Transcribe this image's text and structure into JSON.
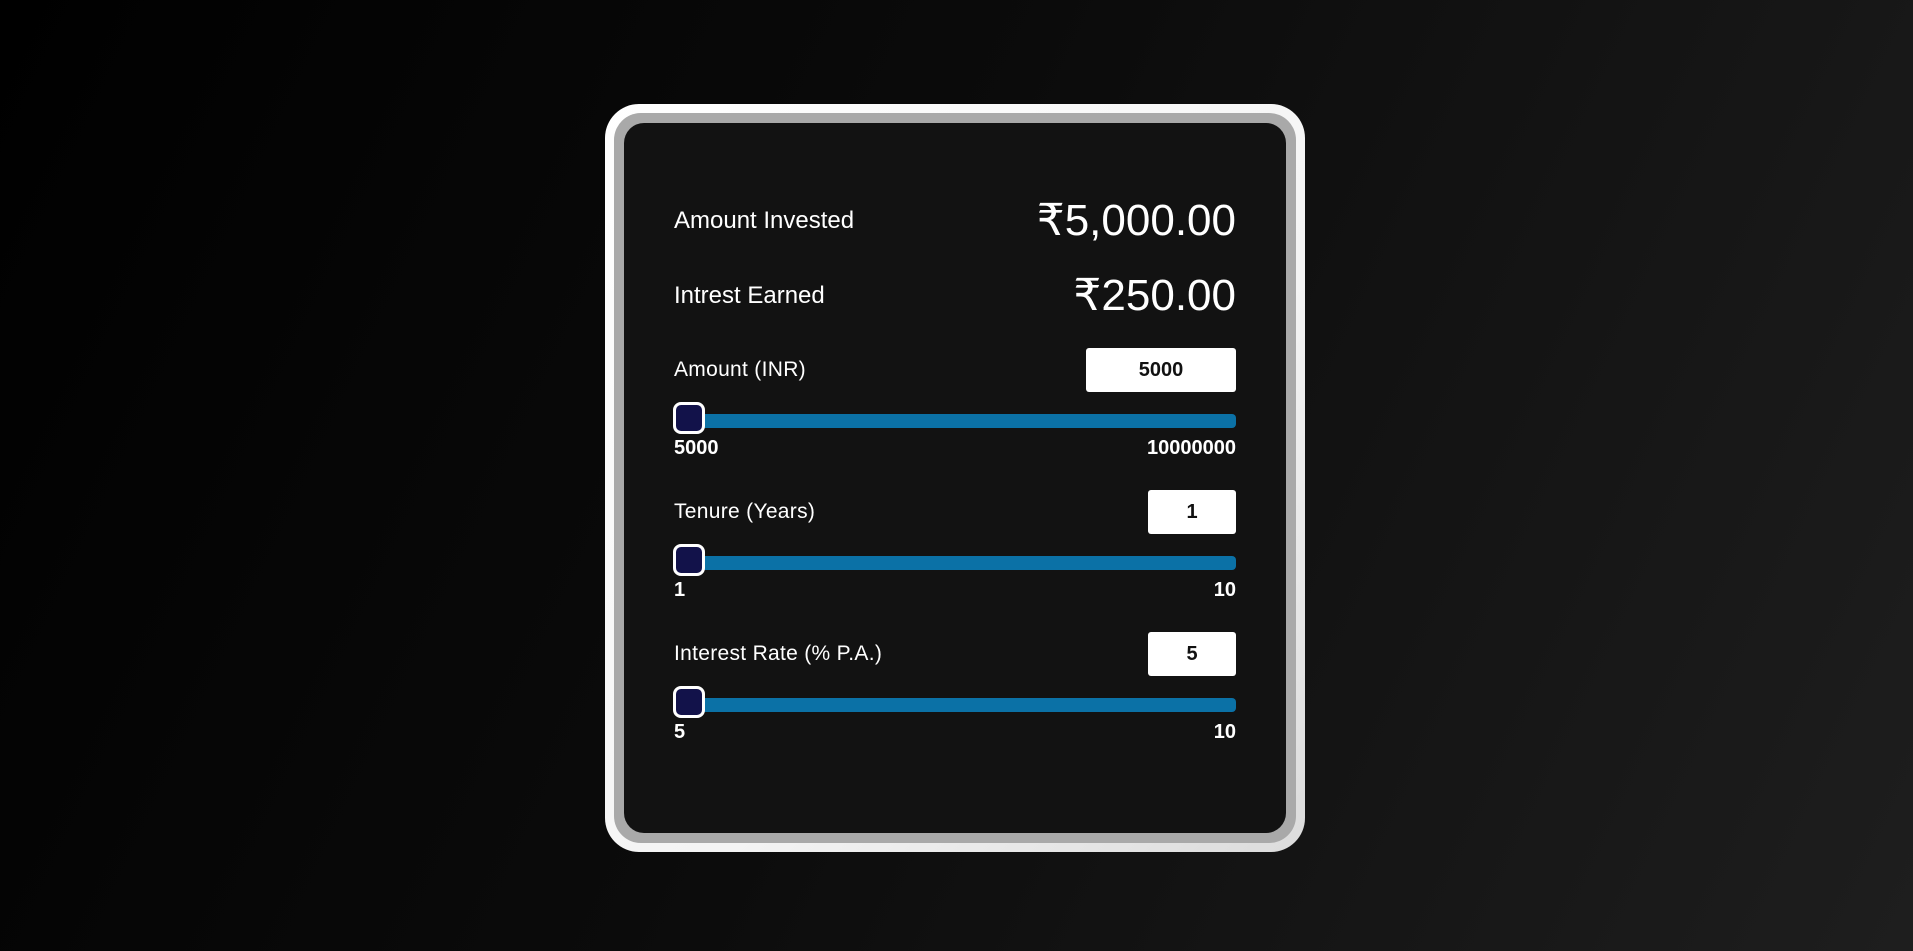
{
  "summary": {
    "invested_label": "Amount Invested",
    "invested_value": "₹5,000.00",
    "interest_label": "Intrest Earned",
    "interest_value": "₹250.00"
  },
  "amount": {
    "label": "Amount (INR)",
    "value": "5000",
    "min": "5000",
    "max": "10000000",
    "slider_position": 0
  },
  "tenure": {
    "label": "Tenure (Years)",
    "value": "1",
    "min": "1",
    "max": "10",
    "slider_position": 0
  },
  "rate": {
    "label": "Interest Rate (% P.A.)",
    "value": "5",
    "min": "5",
    "max": "10",
    "slider_position": 0
  },
  "colors": {
    "track": "#0b71a6",
    "thumb": "#12124a",
    "card": "#121212"
  }
}
